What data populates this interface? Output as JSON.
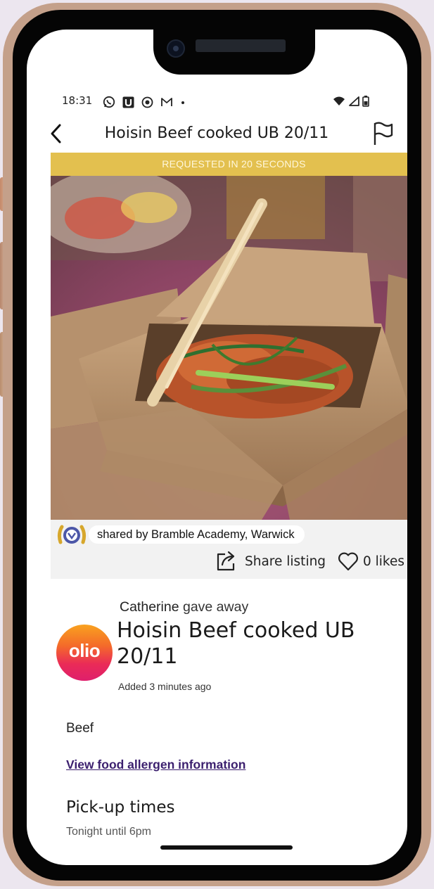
{
  "status_bar": {
    "time": "18:31",
    "left_icons": [
      "whatsapp-icon",
      "u-app-icon",
      "location-pin-icon",
      "gmail-icon",
      "dot-icon"
    ],
    "right_icons": [
      "wifi-icon",
      "signal-icon",
      "battery-icon"
    ]
  },
  "header": {
    "title": "Hoisin Beef cooked UB 20/11",
    "back_icon": "chevron-left-icon",
    "report_icon": "flag-icon"
  },
  "banner": {
    "text": "REQUESTED IN 20 SECONDS",
    "color": "#e3c04f"
  },
  "listing": {
    "shared_by": "shared by Bramble Academy, Warwick",
    "share_label": "Share listing",
    "likes_label": "0 likes",
    "giver_name": "Catherine",
    "giver_action": "gave away",
    "logo_text": "olio",
    "title": "Hoisin Beef cooked UB 20/11",
    "added": "Added 3 minutes ago",
    "category": "Beef",
    "allergen_link": "View food allergen information",
    "pickup_heading": "Pick-up times",
    "pickup_value": "Tonight until 6pm"
  },
  "colors": {
    "accent_banner": "#e3c04f",
    "link": "#3b1f6e",
    "phone_frame": "#c4a08a"
  }
}
